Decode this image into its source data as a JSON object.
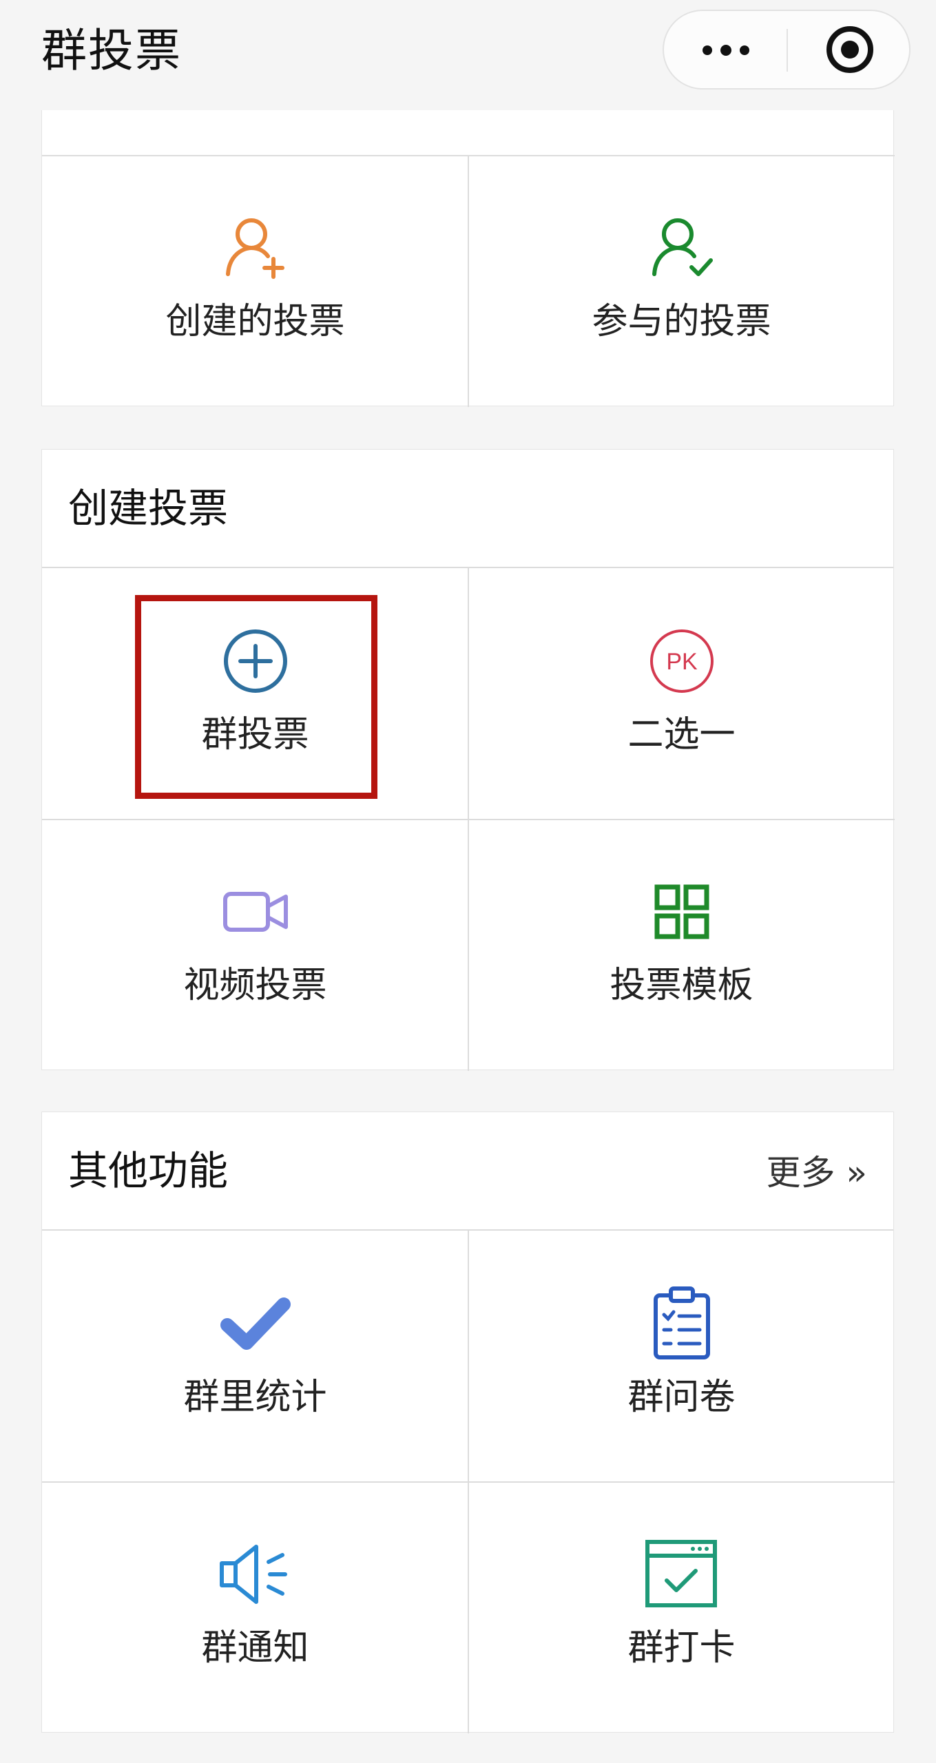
{
  "nav": {
    "title": "群投票"
  },
  "my_votes": {
    "items": [
      {
        "label": "创建的投票",
        "icon": "user-add-icon",
        "color": "#e8873a"
      },
      {
        "label": "参与的投票",
        "icon": "user-check-icon",
        "color": "#1a8a2e"
      }
    ]
  },
  "create_vote": {
    "title": "创建投票",
    "items": [
      {
        "label": "群投票",
        "icon": "plus-circle-icon",
        "color": "#2e6f9e"
      },
      {
        "label": "二选一",
        "icon": "pk-icon",
        "icon_text": "PK",
        "color": "#d4394f"
      },
      {
        "label": "视频投票",
        "icon": "video-camera-icon",
        "color": "#9b8ee0"
      },
      {
        "label": "投票模板",
        "icon": "grid-icon",
        "color": "#1f8a2a"
      }
    ]
  },
  "other_features": {
    "title": "其他功能",
    "more_label": "更多 »",
    "items": [
      {
        "label": "群里统计",
        "icon": "checkmark-icon",
        "color": "#5b83dc"
      },
      {
        "label": "群问卷",
        "icon": "clipboard-list-icon",
        "color": "#2a5bbf"
      },
      {
        "label": "群通知",
        "icon": "speaker-icon",
        "color": "#2a8ad4"
      },
      {
        "label": "群打卡",
        "icon": "calendar-check-icon",
        "color": "#1f9a78"
      }
    ]
  }
}
